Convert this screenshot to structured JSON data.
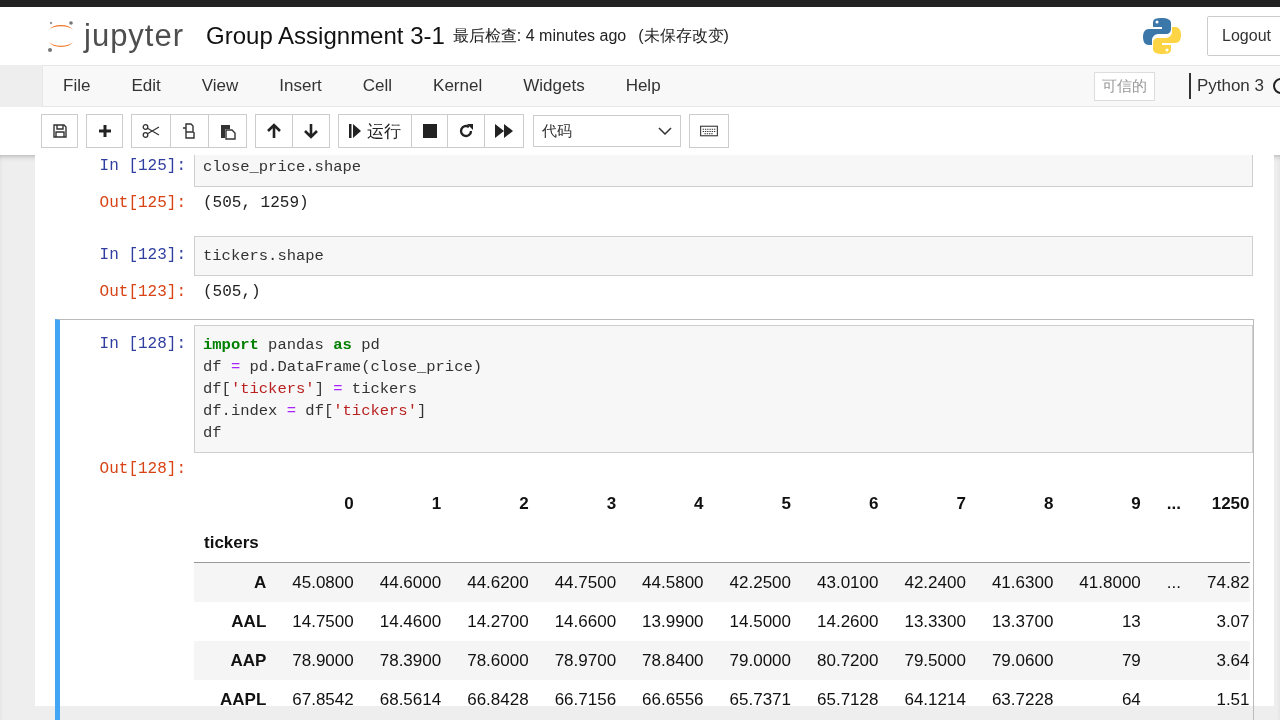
{
  "header": {
    "logo_text": "jupyter",
    "title": "Group Assignment 3-1",
    "checkpoint": "最后检查: 4 minutes ago",
    "autosave": "(未保存改变)",
    "logout": "Logout"
  },
  "menu": {
    "items": [
      "File",
      "Edit",
      "View",
      "Insert",
      "Cell",
      "Kernel",
      "Widgets",
      "Help"
    ],
    "trusted": "可信的",
    "kernel": "Python 3"
  },
  "toolbar": {
    "groups": [
      [
        {
          "kind": "save"
        }
      ],
      [
        {
          "kind": "add"
        }
      ],
      [
        {
          "kind": "cut"
        },
        {
          "kind": "copy"
        },
        {
          "kind": "paste"
        }
      ],
      [
        {
          "kind": "up"
        },
        {
          "kind": "down"
        }
      ],
      [
        {
          "kind": "run",
          "label": "运行"
        },
        {
          "kind": "stop"
        },
        {
          "kind": "restart"
        },
        {
          "kind": "fastforward"
        }
      ]
    ],
    "cell_type": "代码"
  },
  "cells": [
    {
      "prompt": "In [125]:",
      "selected": false,
      "source": [
        [
          {
            "kind": "name",
            "text": "close_price.shape"
          }
        ]
      ],
      "output": {
        "kind": "text",
        "prompt": "Out[125]:",
        "text": "(505, 1259)"
      }
    },
    {
      "prompt": "In [123]:",
      "selected": false,
      "source": [
        [
          {
            "kind": "name",
            "text": "tickers.shape"
          }
        ]
      ],
      "output": {
        "kind": "text",
        "prompt": "Out[123]:",
        "text": "(505,)"
      }
    },
    {
      "prompt": "In [128]:",
      "selected": true,
      "source": [
        [
          {
            "kind": "kw",
            "text": "import"
          },
          {
            "kind": "name",
            "text": " pandas "
          },
          {
            "kind": "kw",
            "text": "as"
          },
          {
            "kind": "name",
            "text": " pd"
          }
        ],
        [
          {
            "kind": "name",
            "text": "df "
          },
          {
            "kind": "op",
            "text": "="
          },
          {
            "kind": "name",
            "text": " pd.DataFrame(close_price)"
          }
        ],
        [
          {
            "kind": "name",
            "text": "df["
          },
          {
            "kind": "str",
            "text": "'tickers'"
          },
          {
            "kind": "name",
            "text": "] "
          },
          {
            "kind": "op",
            "text": "="
          },
          {
            "kind": "name",
            "text": " tickers"
          }
        ],
        [
          {
            "kind": "name",
            "text": "df.index "
          },
          {
            "kind": "op",
            "text": "="
          },
          {
            "kind": "name",
            "text": " df["
          },
          {
            "kind": "str",
            "text": "'tickers'"
          },
          {
            "kind": "name",
            "text": "]"
          }
        ],
        [
          {
            "kind": "name",
            "text": "df"
          }
        ]
      ],
      "output": {
        "kind": "table",
        "prompt": "Out[128]:",
        "columns": [
          "0",
          "1",
          "2",
          "3",
          "4",
          "5",
          "6",
          "7",
          "8",
          "9",
          "...",
          "1250"
        ],
        "index_name": "tickers",
        "rows": [
          {
            "label": "A",
            "cells": [
              "45.0800",
              "44.6000",
              "44.6200",
              "44.7500",
              "44.5800",
              "42.2500",
              "43.0100",
              "42.2400",
              "41.6300",
              "41.8000",
              "...",
              "74.82"
            ]
          },
          {
            "label": "AAL",
            "cells": [
              "14.7500",
              "14.4600",
              "14.2700",
              "14.6600",
              "13.9900",
              "14.5000",
              "14.2600",
              "13.3300",
              "13.3700",
              "13",
              "",
              "3.07"
            ]
          },
          {
            "label": "AAP",
            "cells": [
              "78.9000",
              "78.3900",
              "78.6000",
              "78.9700",
              "78.8400",
              "79.0000",
              "80.7200",
              "79.5000",
              "79.0600",
              "79",
              "",
              "3.64"
            ]
          },
          {
            "label": "AAPL",
            "cells": [
              "67.8542",
              "68.5614",
              "66.8428",
              "66.7156",
              "66.6556",
              "65.7371",
              "65.7128",
              "64.1214",
              "63.7228",
              "64",
              "",
              "1.51"
            ]
          }
        ]
      }
    }
  ]
}
